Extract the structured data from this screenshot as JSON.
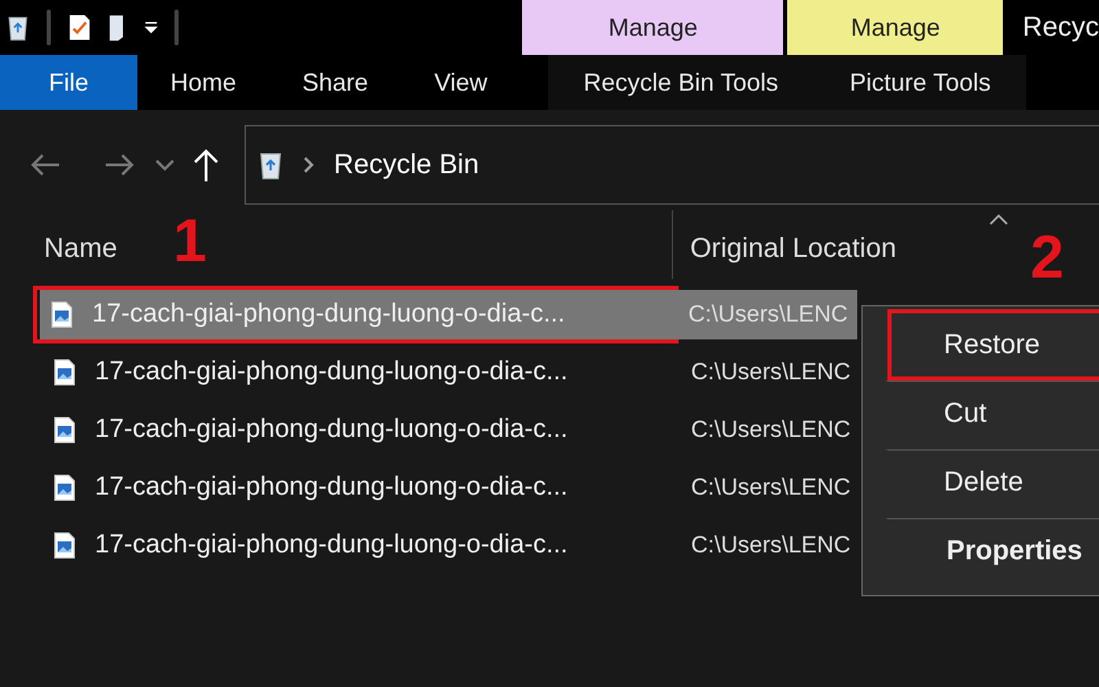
{
  "title_bar": {
    "tool_tabs": [
      {
        "label": "Manage",
        "color": "#e8c8f4"
      },
      {
        "label": "Manage",
        "color": "#f0ee8c"
      }
    ],
    "title": "Recyc"
  },
  "ribbon_tabs": [
    {
      "label": "File",
      "selected": true
    },
    {
      "label": "Home",
      "selected": false
    },
    {
      "label": "Share",
      "selected": false
    },
    {
      "label": "View",
      "selected": false
    },
    {
      "label": "Recycle Bin Tools",
      "selected": false
    },
    {
      "label": "Picture Tools",
      "selected": false
    }
  ],
  "address_bar": {
    "path": "Recycle Bin"
  },
  "columns": [
    "Name",
    "Original Location"
  ],
  "rows": [
    {
      "name": "17-cach-giai-phong-dung-luong-o-dia-c...",
      "location": "C:\\Users\\LENC",
      "selected": true,
      "marked": true
    },
    {
      "name": "17-cach-giai-phong-dung-luong-o-dia-c...",
      "location": "C:\\Users\\LENC",
      "selected": false,
      "marked": false
    },
    {
      "name": "17-cach-giai-phong-dung-luong-o-dia-c...",
      "location": "C:\\Users\\LENC",
      "selected": false,
      "marked": false
    },
    {
      "name": "17-cach-giai-phong-dung-luong-o-dia-c...",
      "location": "C:\\Users\\LENC",
      "selected": false,
      "marked": false
    },
    {
      "name": "17-cach-giai-phong-dung-luong-o-dia-c...",
      "location": "C:\\Users\\LENC",
      "selected": false,
      "marked": false
    }
  ],
  "context_menu": [
    {
      "label": "Restore",
      "default": false,
      "marked": true
    },
    {
      "label": "Cut",
      "default": false,
      "marked": false
    },
    {
      "label": "Delete",
      "default": false,
      "marked": false
    },
    {
      "label": "Properties",
      "default": true,
      "marked": false
    }
  ],
  "callouts": [
    "1",
    "2"
  ]
}
